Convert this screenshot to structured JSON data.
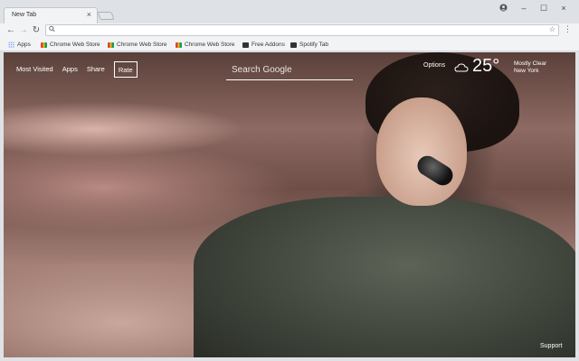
{
  "window": {
    "tab_title": "New Tab",
    "tab_close": "×",
    "controls": {
      "minimize": "–",
      "maximize": "☐",
      "close": "×"
    }
  },
  "toolbar": {
    "back": "←",
    "forward": "→",
    "reload": "↻",
    "address_value": "",
    "star": "☆",
    "menu": "⋮"
  },
  "bookmarks": [
    {
      "label": "Apps",
      "icon": "apps-grid-icon"
    },
    {
      "label": "Chrome Web Store",
      "icon": "chrome-web-store-icon"
    },
    {
      "label": "Chrome Web Store",
      "icon": "chrome-web-store-icon"
    },
    {
      "label": "Chrome Web Store",
      "icon": "chrome-web-store-icon"
    },
    {
      "label": "Free Addons",
      "icon": "addon-icon"
    },
    {
      "label": "Spotify Tab",
      "icon": "addon-icon"
    }
  ],
  "page": {
    "nav": [
      "Most Visited",
      "Apps",
      "Share",
      "Rate"
    ],
    "search_placeholder": "Search Google",
    "options": "Options",
    "weather": {
      "temperature": "25°",
      "condition": "Mostly Clear",
      "location": "New York"
    },
    "support": "Support"
  }
}
